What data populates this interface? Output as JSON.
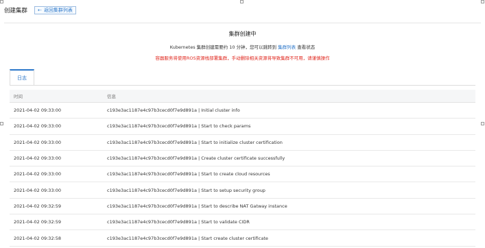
{
  "header": {
    "title": "创建集群",
    "back_button": "返回集群列表"
  },
  "status": {
    "title": "集群创建中",
    "desc_prefix": "Kubernetes 集群创建需要约 10 分钟，您可以跳转到",
    "desc_link": "集群列表",
    "desc_suffix": "查看状态",
    "warning": "容器服务将使用ROS资源栈部署集群，手动删除相关资源将导致集群不可用，请谨慎操作",
    "warning_color": "#e0281f",
    "accent_color": "#2a76c9"
  },
  "tabs": [
    {
      "label": "日志",
      "active": true
    }
  ],
  "log_table": {
    "columns": [
      "时间",
      "信息"
    ],
    "rows": [
      {
        "time": "2021-04-02 09:33:00",
        "message": "c193e3ac1187e4c97b3cecd0f7e9d891a | Initial cluster info"
      },
      {
        "time": "2021-04-02 09:33:00",
        "message": "c193e3ac1187e4c97b3cecd0f7e9d891a | Start to check params"
      },
      {
        "time": "2021-04-02 09:33:00",
        "message": "c193e3ac1187e4c97b3cecd0f7e9d891a | Start to initialize cluster certification"
      },
      {
        "time": "2021-04-02 09:33:00",
        "message": "c193e3ac1187e4c97b3cecd0f7e9d891a | Create cluster certificate successfully"
      },
      {
        "time": "2021-04-02 09:33:00",
        "message": "c193e3ac1187e4c97b3cecd0f7e9d891a | Start to create cloud resources"
      },
      {
        "time": "2021-04-02 09:33:00",
        "message": "c193e3ac1187e4c97b3cecd0f7e9d891a | Start to setup security group"
      },
      {
        "time": "2021-04-02 09:32:59",
        "message": "c193e3ac1187e4c97b3cecd0f7e9d891a | Start to describe NAT Gatway instance"
      },
      {
        "time": "2021-04-02 09:32:59",
        "message": "c193e3ac1187e4c97b3cecd0f7e9d891a | Start to validate CIDR"
      },
      {
        "time": "2021-04-02 09:32:58",
        "message": "c193e3ac1187e4c97b3cecd0f7e9d891a | Start create cluster certificate"
      }
    ]
  }
}
